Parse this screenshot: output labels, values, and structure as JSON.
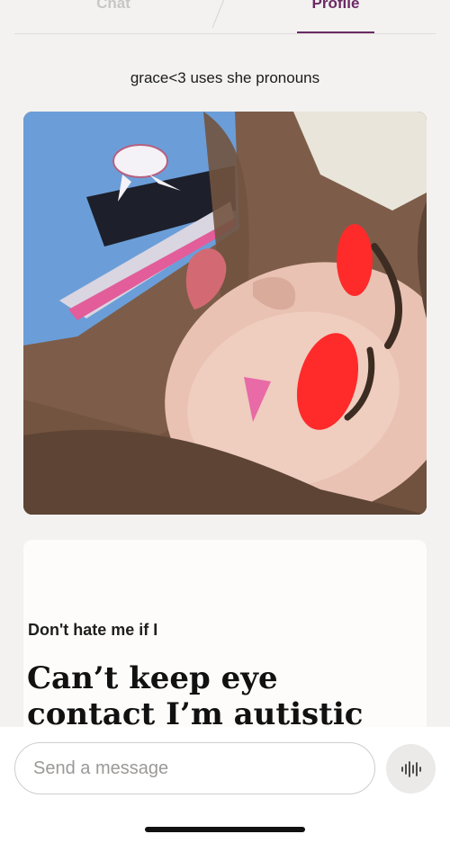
{
  "tabs": {
    "chat_label": "Chat",
    "profile_label": "Profile",
    "active": "Profile"
  },
  "profile": {
    "name_line": "grace<3 uses she pronouns"
  },
  "prompt": {
    "question": "Don't hate me if I",
    "answer": "Can’t keep eye contact I’m autistic asf"
  },
  "composer": {
    "placeholder": "Send a message"
  },
  "icons": {
    "voice": "voice-waveform-icon"
  },
  "colors": {
    "accent": "#6b2a63",
    "background": "#f3f2f1"
  }
}
